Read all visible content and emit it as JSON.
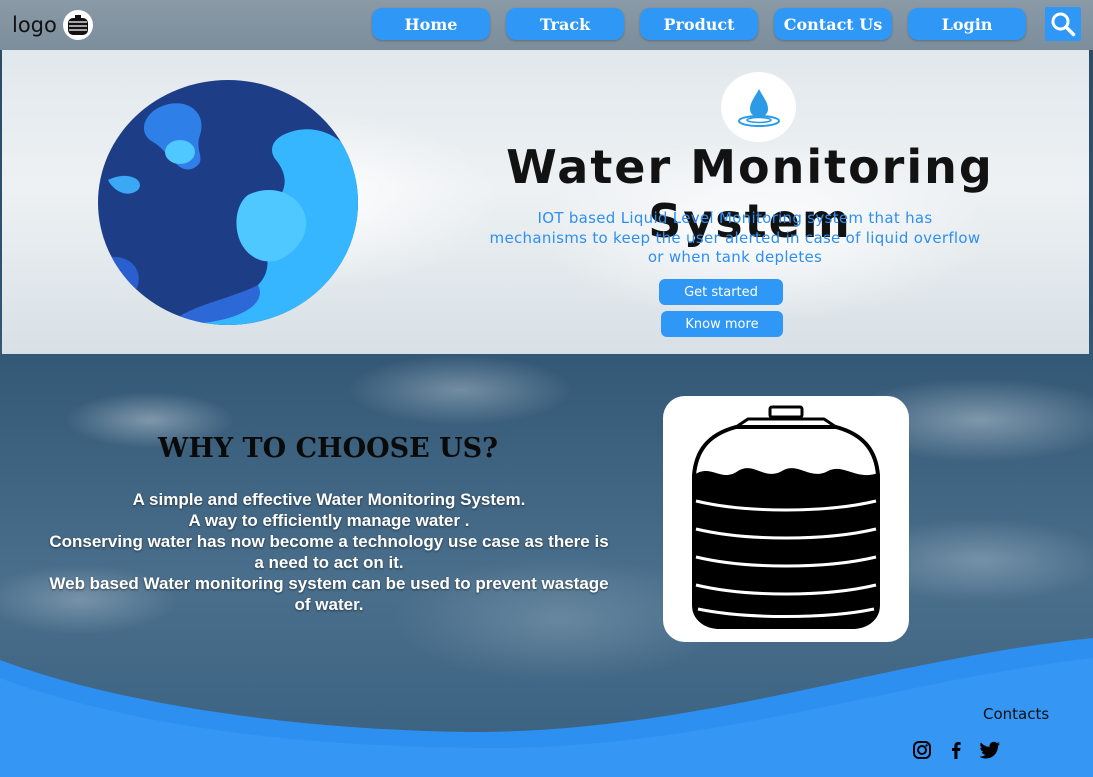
{
  "header": {
    "logo_text": "logo",
    "nav": [
      {
        "label": "Home"
      },
      {
        "label": "Track"
      },
      {
        "label": "Product"
      },
      {
        "label": "Contact Us"
      },
      {
        "label": "Login"
      }
    ],
    "search_icon": "search-icon"
  },
  "hero": {
    "title": "Water Monitoring System",
    "subtitle_lines": [
      "IOT based Liquid Level Monitoring system that has",
      "mechanisms to keep the user alerted in case of liquid overflow",
      "or when tank depletes"
    ],
    "get_started_label": "Get started",
    "know_more_label": "Know more"
  },
  "why": {
    "title": "WHY TO CHOOSE US?",
    "lines": [
      "A simple and effective Water Monitoring System.",
      "A way to efficiently manage water .",
      "Conserving water has now become a technology use case as there is",
      "a need to act on it.",
      "Web based Water monitoring system can be used to prevent wastage",
      "of water."
    ]
  },
  "footer": {
    "contacts_label": "Contacts",
    "social_icons": [
      "instagram-icon",
      "facebook-icon",
      "twitter-icon"
    ]
  },
  "colors": {
    "accent": "#2f97f5",
    "subtitle": "#2f8ff0",
    "blob_dark": "#1d3e86",
    "blob_light": "#35b6ff"
  }
}
